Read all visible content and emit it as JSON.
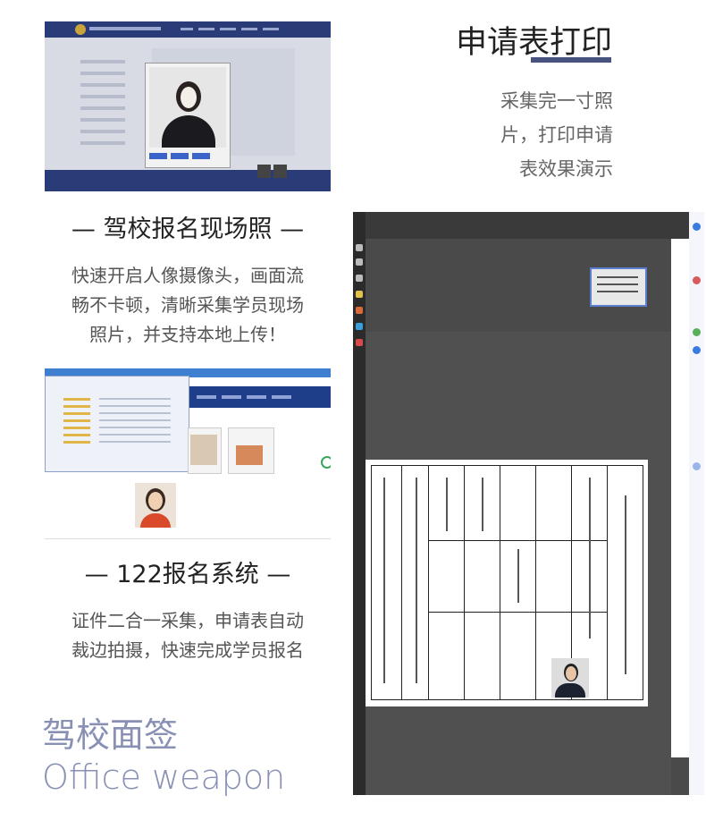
{
  "print_section": {
    "title": "申请表打印",
    "desc_lines": [
      "采集完一寸照",
      "片，打印申请",
      "表效果演示"
    ]
  },
  "onsite_section": {
    "title": "— 驾校报名现场照 —",
    "desc_lines": [
      "快速开启人像摄像头，画面流",
      "畅不卡顿，清晰采集学员现场",
      "照片，并支持本地上传！"
    ]
  },
  "system_section": {
    "title": "— 122报名系统 —",
    "desc_lines": [
      "证件二合一采集，申请表自动",
      "裁边拍摄，快速完成学员报名"
    ]
  },
  "brand": {
    "name_cn": "驾校面签",
    "name_en": "Office weapon"
  },
  "colors": {
    "accent": "#48527e",
    "brand_text": "#8890b4",
    "heading": "#222222",
    "body_text": "#555555"
  }
}
